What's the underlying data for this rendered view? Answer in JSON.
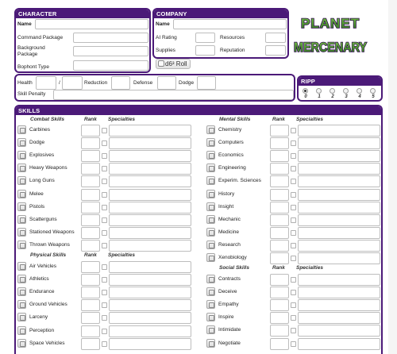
{
  "character": {
    "title": "CHARACTER",
    "fields": [
      "Name",
      "Command Package",
      "Background Package",
      "Bophont Type"
    ]
  },
  "company": {
    "title": "COMPANY",
    "name_label": "Name",
    "ai_rating_label": "AI Rating",
    "resources_label": "Resources",
    "supplies_label": "Supplies",
    "reputation_label": "Reputation",
    "roll_label": "d6³ Roll"
  },
  "logo": {
    "line1": "PLANET",
    "line2": "MERCENARY"
  },
  "health": {
    "health_label": "Health",
    "slash": "/",
    "reduction_label": "Reduction",
    "defense_label": "Defense",
    "dodge_label": "Dodge",
    "skill_penalty_label": "Skill Penalty"
  },
  "ripp": {
    "title": "RIPP",
    "options": [
      "0",
      "1",
      "2",
      "3",
      "4",
      "5"
    ],
    "selected": "0"
  },
  "skills": {
    "title": "SKILLS",
    "rank_header": "Rank",
    "specialties_header": "Specialties",
    "combat": {
      "title": "Combat Skills",
      "items": [
        "Carbines",
        "Dodge",
        "Explosives",
        "Heavy Weapons",
        "Long Guns",
        "Melee",
        "Pistols",
        "Scatterguns",
        "Stationed Weapons",
        "Thrown Weapons"
      ]
    },
    "physical": {
      "title": "Physical Skills",
      "items": [
        "Air Vehicles",
        "Athletics",
        "Endurance",
        "Ground Vehicles",
        "Larceny",
        "Perception",
        "Space Vehicles"
      ]
    },
    "mental": {
      "title": "Mental Skills",
      "items": [
        "Chemistry",
        "Computers",
        "Economics",
        "Engineering",
        "Experim. Sciences",
        "History",
        "Insight",
        "Mechanic",
        "Medicine",
        "Research",
        "Xenobiology"
      ]
    },
    "social": {
      "title": "Social Skills",
      "items": [
        "Contracts",
        "Deceive",
        "Empathy",
        "Inspire",
        "Intimidate",
        "Negotiate"
      ]
    }
  },
  "colors": {
    "panel": "#4b1a78",
    "logo_fill": "#3d8a2a",
    "logo_outline": "#2b0a4a"
  }
}
